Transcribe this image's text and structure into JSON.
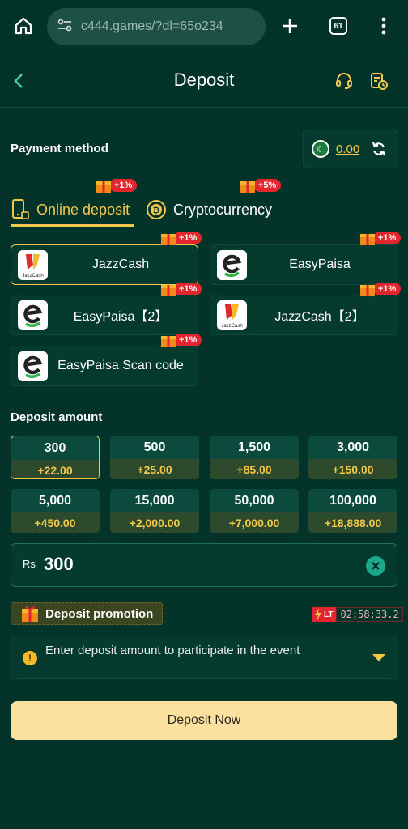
{
  "browser": {
    "url": "c444.games/?dl=65o234",
    "tab_count": "61"
  },
  "header": {
    "title": "Deposit"
  },
  "payment": {
    "label": "Payment method",
    "balance": "0.00",
    "tabs": [
      {
        "label": "Online deposit",
        "badge": "+1%"
      },
      {
        "label": "Cryptocurrency",
        "badge": "+5%"
      }
    ],
    "methods": [
      {
        "name": "JazzCash",
        "badge": "+1%",
        "logo": "JazzCash"
      },
      {
        "name": "EasyPaisa",
        "badge": "+1%",
        "logo": ""
      },
      {
        "name": "EasyPaisa【2】",
        "badge": "+1%",
        "logo": ""
      },
      {
        "name": "JazzCash【2】",
        "badge": "+1%",
        "logo": "JazzCash"
      },
      {
        "name": "EasyPaisa Scan code",
        "badge": "+1%",
        "logo": ""
      }
    ]
  },
  "deposit": {
    "label": "Deposit amount",
    "amounts": [
      {
        "value": "300",
        "bonus": "+22.00"
      },
      {
        "value": "500",
        "bonus": "+25.00"
      },
      {
        "value": "1,500",
        "bonus": "+85.00"
      },
      {
        "value": "3,000",
        "bonus": "+150.00"
      },
      {
        "value": "5,000",
        "bonus": "+450.00"
      },
      {
        "value": "15,000",
        "bonus": "+2,000.00"
      },
      {
        "value": "50,000",
        "bonus": "+7,000.00"
      },
      {
        "value": "100,000",
        "bonus": "+18,888.00"
      }
    ],
    "currency": "Rs",
    "input_value": "300"
  },
  "promotion": {
    "label": "Deposit promotion",
    "lt": "LT",
    "timer": "02:58:33.2",
    "placeholder": "Enter deposit amount to participate in the event"
  },
  "submit": {
    "label": "Deposit Now"
  },
  "colors": {
    "background": "#04332a",
    "accent": "#f5c84a",
    "badge": "#e3262d",
    "button": "#fbe0a0"
  }
}
